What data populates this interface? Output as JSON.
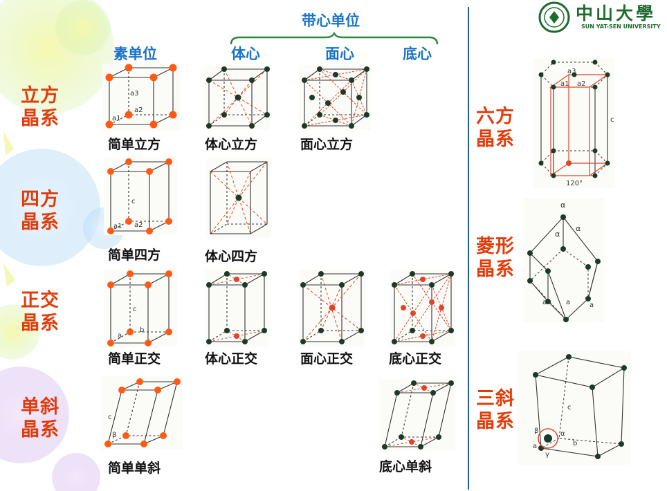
{
  "header": {
    "bravais_group_label": "带心单位",
    "columns": {
      "primitive": "素单位",
      "body_centered": "体心",
      "face_centered": "面心",
      "base_centered": "底心"
    }
  },
  "systems": {
    "cubic": "立方\n晶系",
    "tetragonal": "四方\n晶系",
    "orthorhombic": "正交\n晶系",
    "monoclinic": "单斜\n晶系",
    "hexagonal": "六方\n晶系",
    "rhombohedral": "菱形\n晶系",
    "triclinic": "三斜\n晶系"
  },
  "captions": {
    "simple_cubic": "简单立方",
    "bcc": "体心立方",
    "fcc": "面心立方",
    "simple_tetragonal": "简单四方",
    "body_tetragonal": "体心四方",
    "simple_orthorhombic": "简单正交",
    "body_orthorhombic": "体心正交",
    "face_orthorhombic": "面心正交",
    "base_orthorhombic": "底心正交",
    "simple_monoclinic": "简单单斜",
    "base_monoclinic": "底心单斜"
  },
  "lattice_labels": {
    "a1": "a1",
    "a2": "a2",
    "a3": "a3",
    "a": "a",
    "b": "b",
    "c": "c",
    "alpha": "α",
    "beta": "β",
    "gamma": "γ",
    "hex_angle": "120°"
  },
  "logo": {
    "name_cn": "中山大學",
    "name_en": "SUN YAT-SEN UNIVERSITY"
  },
  "colors": {
    "system_label": "#e03c0a",
    "header_label": "#1a73c8",
    "bracket": "#2a8a3a",
    "divider": "#1f5fa8",
    "atom_orange": "#ff5a14",
    "atom_dark": "#1c3a28",
    "dashed_red": "#e0442a"
  }
}
